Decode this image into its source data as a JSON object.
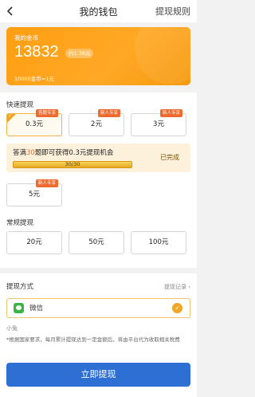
{
  "header": {
    "title": "我的钱包",
    "rule_link": "提现规则"
  },
  "wallet": {
    "label": "我的金币",
    "coins": "13832",
    "approx": "约1.38元",
    "rate": "10000金币=1元",
    "color": "#ffa21a"
  },
  "quick": {
    "title": "快速提现",
    "options": [
      {
        "tag": "答题专享",
        "value": "0.3元",
        "selected": true
      },
      {
        "tag": "新人专享",
        "value": "2元"
      },
      {
        "tag": "新人专享",
        "value": "3元"
      },
      {
        "tag": "新人专享",
        "value": "5元"
      }
    ],
    "task": {
      "text_pre": "答满",
      "highlight": "30",
      "text_post": "题即可获得0.3元提现机会",
      "progress_text": "30/30",
      "progress": 1.0,
      "status": "已完成"
    }
  },
  "regular": {
    "title": "常规提现",
    "options": [
      "20元",
      "50元",
      "100元"
    ]
  },
  "payout": {
    "title": "提现方式",
    "records_link": "提现记录 ›",
    "method": "微信",
    "account": "小兔",
    "notice": "*根据国家要求，每月累计提现达到一定金额后，将由平台代为收取相关税费"
  },
  "submit_label": "立即提现",
  "accent": "#f1a524",
  "button_color": "#2e6fd3"
}
